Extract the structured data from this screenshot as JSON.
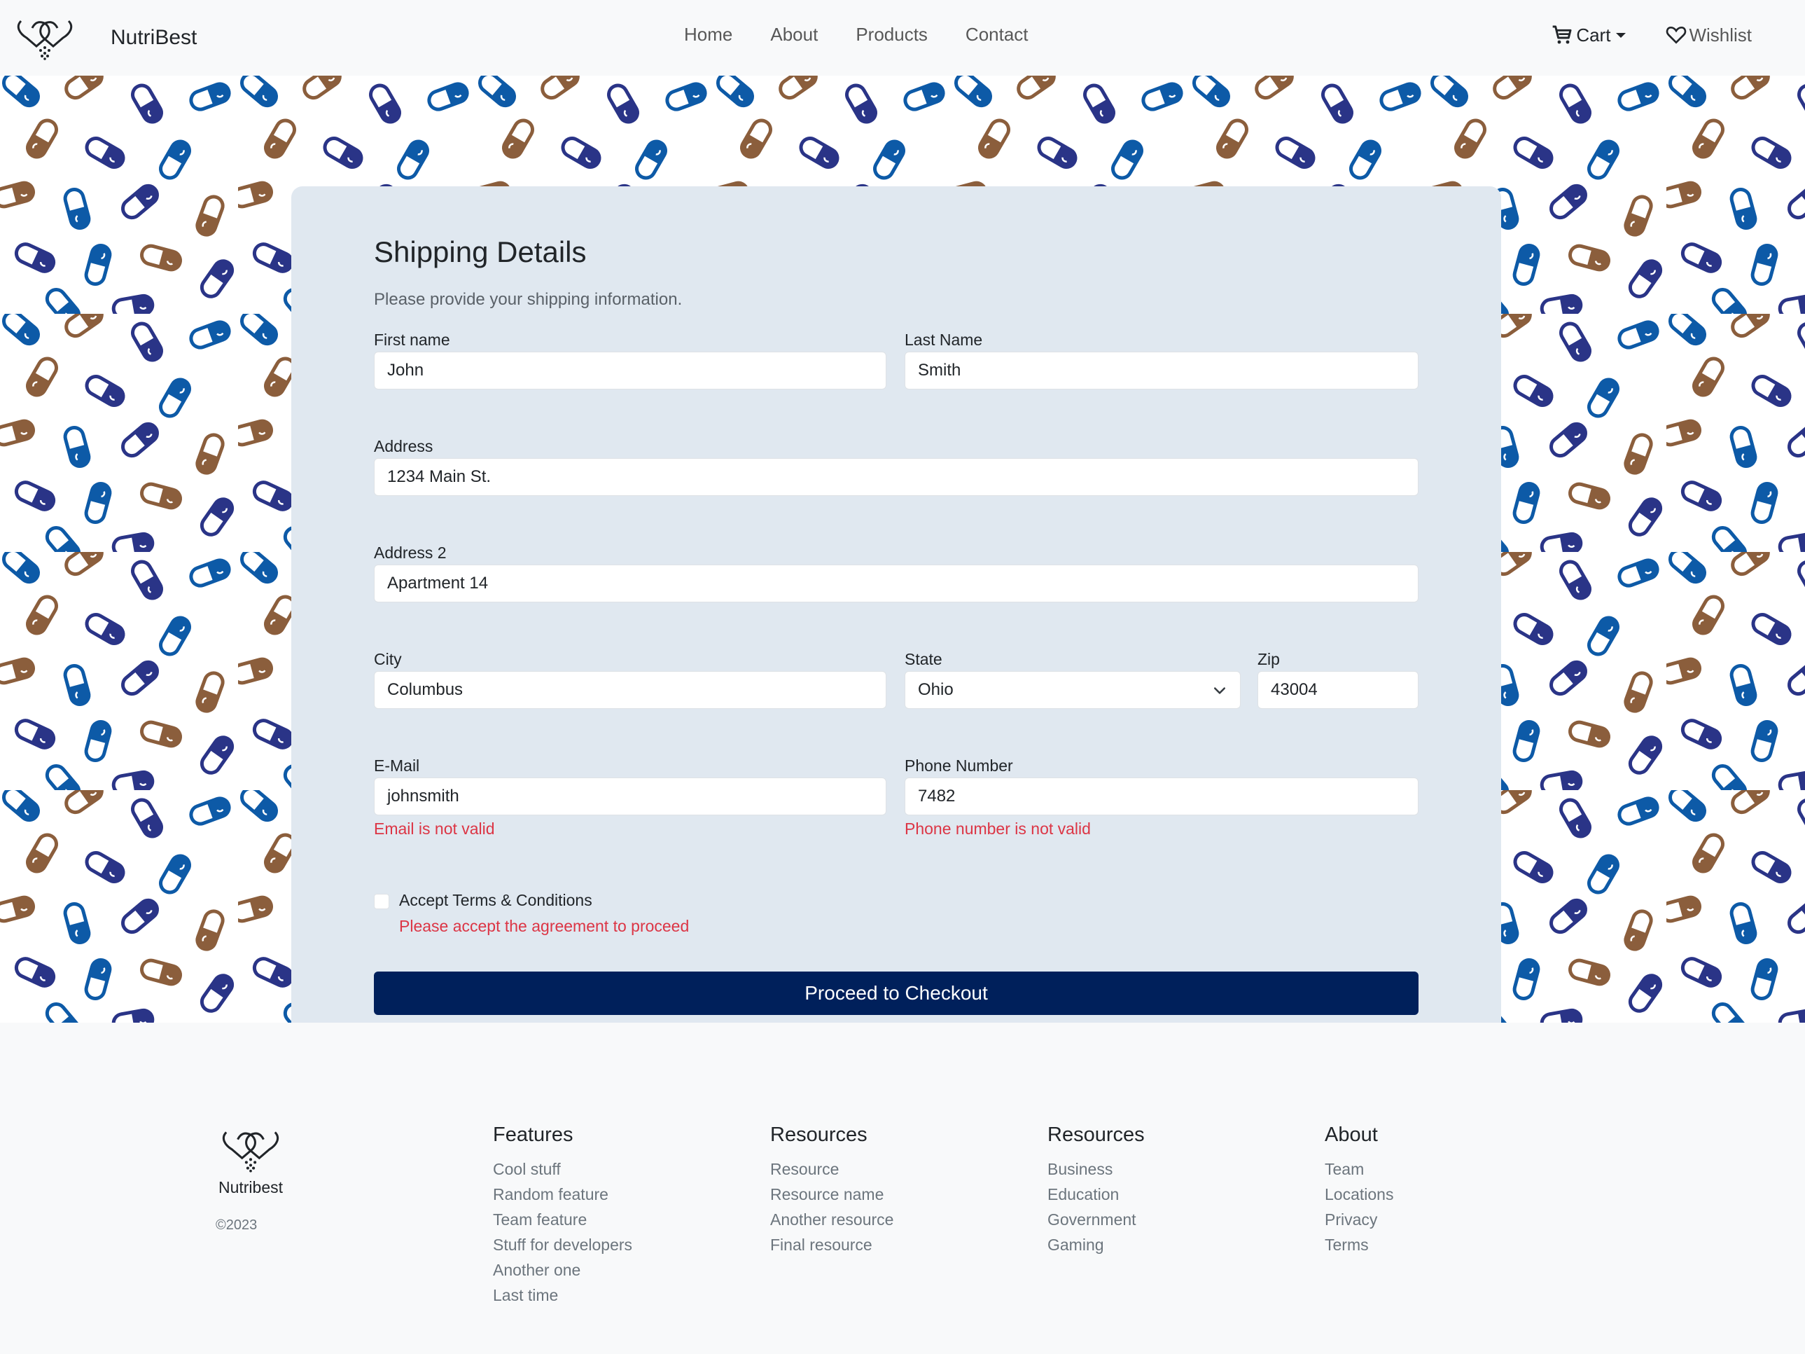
{
  "navbar": {
    "brand_name": "NutriBest",
    "links": [
      "Home",
      "About",
      "Products",
      "Contact"
    ],
    "cart_label": "Cart",
    "wishlist_label": "Wishlist",
    "icons": [
      "logo-hearts-pill",
      "cart-icon",
      "caret-down-icon",
      "heart-icon"
    ]
  },
  "form": {
    "title": "Shipping Details",
    "subtitle": "Please provide your shipping information.",
    "first_name": {
      "label": "First name",
      "value": "John"
    },
    "last_name": {
      "label": "Last Name",
      "value": "Smith"
    },
    "address": {
      "label": "Address",
      "value": "1234 Main St."
    },
    "address2": {
      "label": "Address 2",
      "value": "Apartment 14"
    },
    "city": {
      "label": "City",
      "value": "Columbus"
    },
    "state": {
      "label": "State",
      "value": "Ohio"
    },
    "zip": {
      "label": "Zip",
      "value": "43004"
    },
    "email": {
      "label": "E-Mail",
      "value": "johnsmith",
      "error": "Email is not valid"
    },
    "phone": {
      "label": "Phone Number",
      "value": "7482",
      "error": "Phone number is not valid"
    },
    "terms": {
      "label": "Accept Terms & Conditions",
      "error": "Please accept the agreement to proceed"
    },
    "submit_label": "Proceed to Checkout"
  },
  "footer": {
    "brand_name": "Nutribest",
    "copyright": "©2023",
    "columns": [
      {
        "title": "Features",
        "items": [
          "Cool stuff",
          "Random feature",
          "Team feature",
          "Stuff for developers",
          "Another one",
          "Last time"
        ]
      },
      {
        "title": "Resources",
        "items": [
          "Resource",
          "Resource name",
          "Another resource",
          "Final resource"
        ]
      },
      {
        "title": "Resources",
        "items": [
          "Business",
          "Education",
          "Government",
          "Gaming"
        ]
      },
      {
        "title": "About",
        "items": [
          "Team",
          "Locations",
          "Privacy",
          "Terms"
        ]
      }
    ]
  },
  "colors": {
    "primary_button": "#00205b",
    "error": "#dc3545",
    "card_bg": "#e0e8f0",
    "pill_blue": "#0d5aa7",
    "pill_navy": "#2a3487",
    "pill_brown": "#8b5e3c"
  }
}
